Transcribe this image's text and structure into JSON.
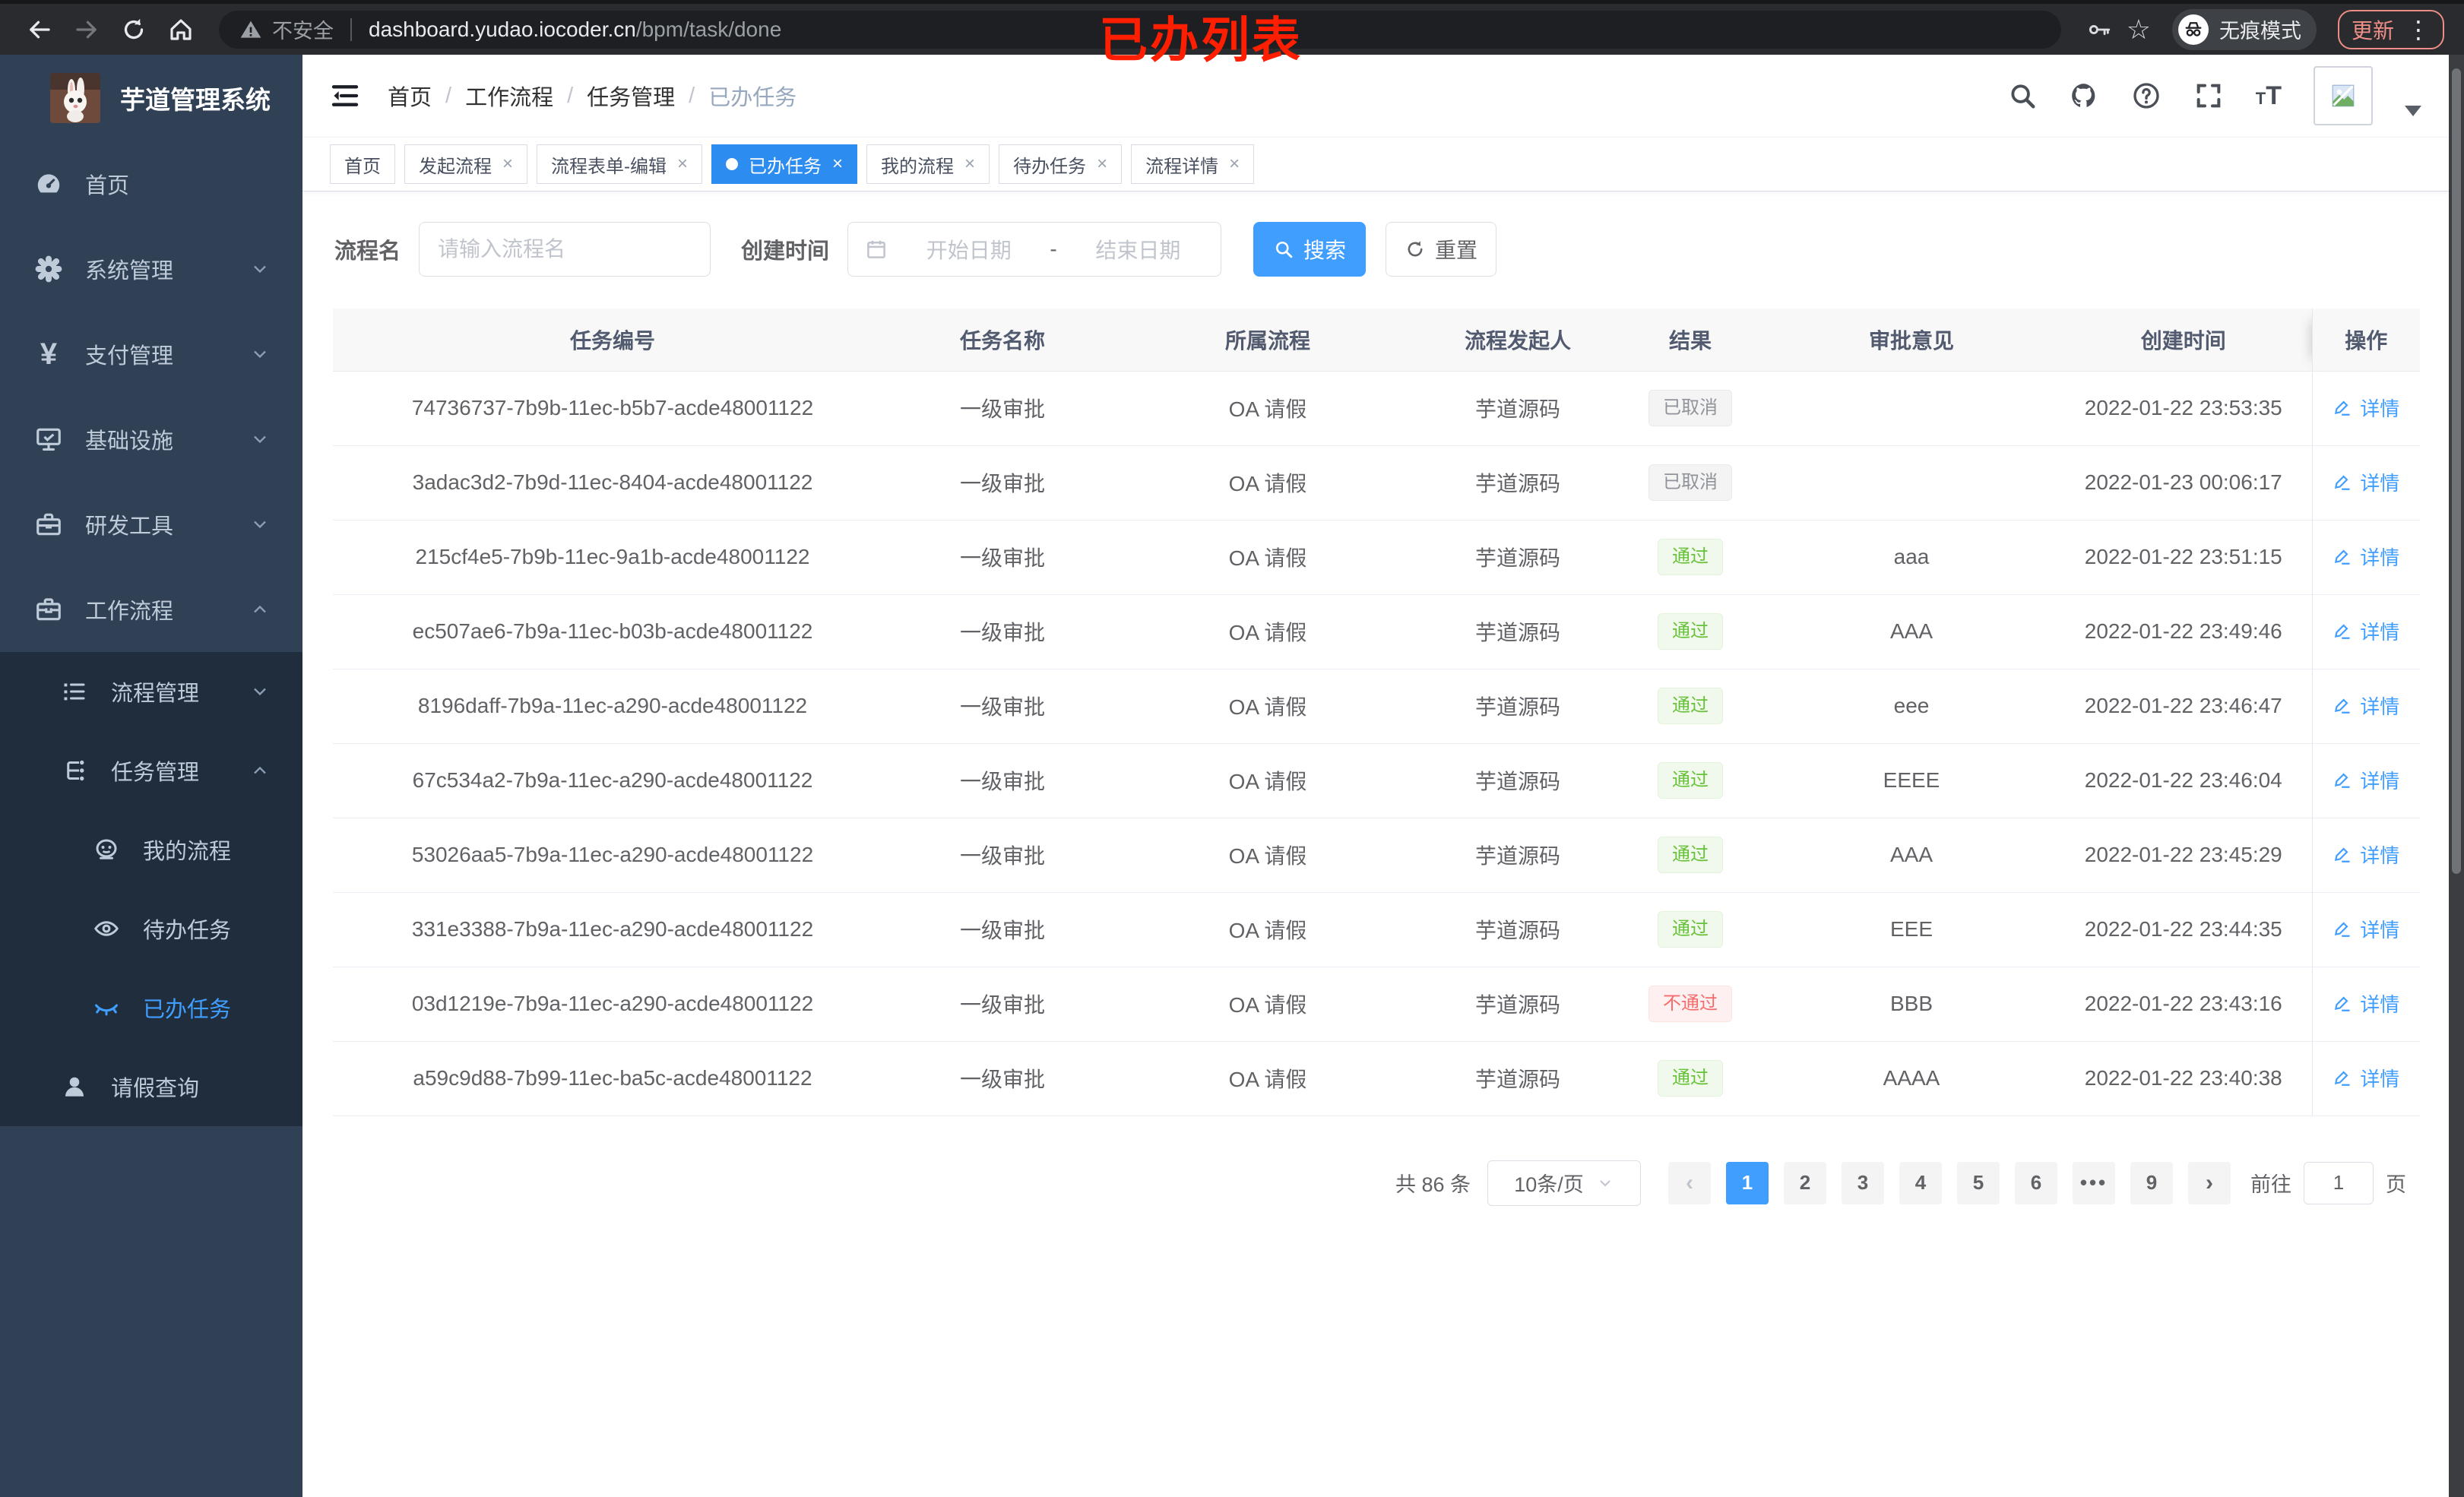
{
  "colors": {
    "accent": "#409eff",
    "tab_active": "#2d8cf0",
    "success": "#67c23a",
    "danger": "#f56c6c",
    "info": "#909399",
    "sidebar_bg": "#304156",
    "submenu_bg": "#1f2d3d",
    "annotation_red": "#ff1f00"
  },
  "browser": {
    "security_label": "不安全",
    "url_host": "dashboard.yudao.iocoder.cn",
    "url_path": "/bpm/task/done",
    "incognito_label": "无痕模式",
    "update_label": "更新",
    "annotation": "已办列表"
  },
  "sidebar": {
    "title": "芋道管理系统",
    "items": [
      {
        "label": "首页",
        "icon": "dashboard-icon"
      },
      {
        "label": "系统管理",
        "icon": "gear-icon",
        "arrow": "down"
      },
      {
        "label": "支付管理",
        "icon": "yen-icon",
        "arrow": "down"
      },
      {
        "label": "基础设施",
        "icon": "monitor-icon",
        "arrow": "down"
      },
      {
        "label": "研发工具",
        "icon": "toolbox-icon",
        "arrow": "down"
      },
      {
        "label": "工作流程",
        "icon": "briefcase-icon",
        "arrow": "up"
      }
    ],
    "sub_items": [
      {
        "label": "流程管理",
        "icon": "list-icon",
        "arrow": "down"
      },
      {
        "label": "任务管理",
        "icon": "tree-icon",
        "arrow": "up"
      },
      {
        "label": "我的流程",
        "icon": "face-icon"
      },
      {
        "label": "待办任务",
        "icon": "eye-icon"
      },
      {
        "label": "已办任务",
        "icon": "eye-off-icon",
        "active": true
      },
      {
        "label": "请假查询",
        "icon": "user-icon"
      }
    ]
  },
  "header": {
    "breadcrumb": [
      "首页",
      "工作流程",
      "任务管理",
      "已办任务"
    ]
  },
  "tabs": [
    {
      "label": "首页"
    },
    {
      "label": "发起流程"
    },
    {
      "label": "流程表单-编辑"
    },
    {
      "label": "已办任务",
      "active": true
    },
    {
      "label": "我的流程"
    },
    {
      "label": "待办任务"
    },
    {
      "label": "流程详情"
    }
  ],
  "filters": {
    "name_label": "流程名",
    "name_placeholder": "请输入流程名",
    "time_label": "创建时间",
    "start_placeholder": "开始日期",
    "range_separator": "-",
    "end_placeholder": "结束日期",
    "search_label": "搜索",
    "reset_label": "重置"
  },
  "table": {
    "headers": [
      "任务编号",
      "任务名称",
      "所属流程",
      "流程发起人",
      "结果",
      "审批意见",
      "创建时间",
      "操作"
    ],
    "action_label": "详情",
    "rows": [
      {
        "id": "74736737-7b9b-11ec-b5b7-acde48001122",
        "name": "一级审批",
        "flow": "OA 请假",
        "starter": "芋道源码",
        "result": "已取消",
        "result_type": "info",
        "comment": "",
        "time": "2022-01-22 23:53:35"
      },
      {
        "id": "3adac3d2-7b9d-11ec-8404-acde48001122",
        "name": "一级审批",
        "flow": "OA 请假",
        "starter": "芋道源码",
        "result": "已取消",
        "result_type": "info",
        "comment": "",
        "time": "2022-01-23 00:06:17"
      },
      {
        "id": "215cf4e5-7b9b-11ec-9a1b-acde48001122",
        "name": "一级审批",
        "flow": "OA 请假",
        "starter": "芋道源码",
        "result": "通过",
        "result_type": "success",
        "comment": "aaa",
        "time": "2022-01-22 23:51:15"
      },
      {
        "id": "ec507ae6-7b9a-11ec-b03b-acde48001122",
        "name": "一级审批",
        "flow": "OA 请假",
        "starter": "芋道源码",
        "result": "通过",
        "result_type": "success",
        "comment": "AAA",
        "time": "2022-01-22 23:49:46"
      },
      {
        "id": "8196daff-7b9a-11ec-a290-acde48001122",
        "name": "一级审批",
        "flow": "OA 请假",
        "starter": "芋道源码",
        "result": "通过",
        "result_type": "success",
        "comment": "eee",
        "time": "2022-01-22 23:46:47"
      },
      {
        "id": "67c534a2-7b9a-11ec-a290-acde48001122",
        "name": "一级审批",
        "flow": "OA 请假",
        "starter": "芋道源码",
        "result": "通过",
        "result_type": "success",
        "comment": "EEEE",
        "time": "2022-01-22 23:46:04"
      },
      {
        "id": "53026aa5-7b9a-11ec-a290-acde48001122",
        "name": "一级审批",
        "flow": "OA 请假",
        "starter": "芋道源码",
        "result": "通过",
        "result_type": "success",
        "comment": "AAA",
        "time": "2022-01-22 23:45:29"
      },
      {
        "id": "331e3388-7b9a-11ec-a290-acde48001122",
        "name": "一级审批",
        "flow": "OA 请假",
        "starter": "芋道源码",
        "result": "通过",
        "result_type": "success",
        "comment": "EEE",
        "time": "2022-01-22 23:44:35"
      },
      {
        "id": "03d1219e-7b9a-11ec-a290-acde48001122",
        "name": "一级审批",
        "flow": "OA 请假",
        "starter": "芋道源码",
        "result": "不通过",
        "result_type": "danger",
        "comment": "BBB",
        "time": "2022-01-22 23:43:16"
      },
      {
        "id": "a59c9d88-7b99-11ec-ba5c-acde48001122",
        "name": "一级审批",
        "flow": "OA 请假",
        "starter": "芋道源码",
        "result": "通过",
        "result_type": "success",
        "comment": "AAAA",
        "time": "2022-01-22 23:40:38"
      }
    ]
  },
  "pagination": {
    "total": "共 86 条",
    "page_size": "10条/页",
    "pages": [
      "1",
      "2",
      "3",
      "4",
      "5",
      "6"
    ],
    "more": "•••",
    "last_page": "9",
    "goto_label": "前往",
    "goto_value": "1",
    "page_unit": "页"
  }
}
